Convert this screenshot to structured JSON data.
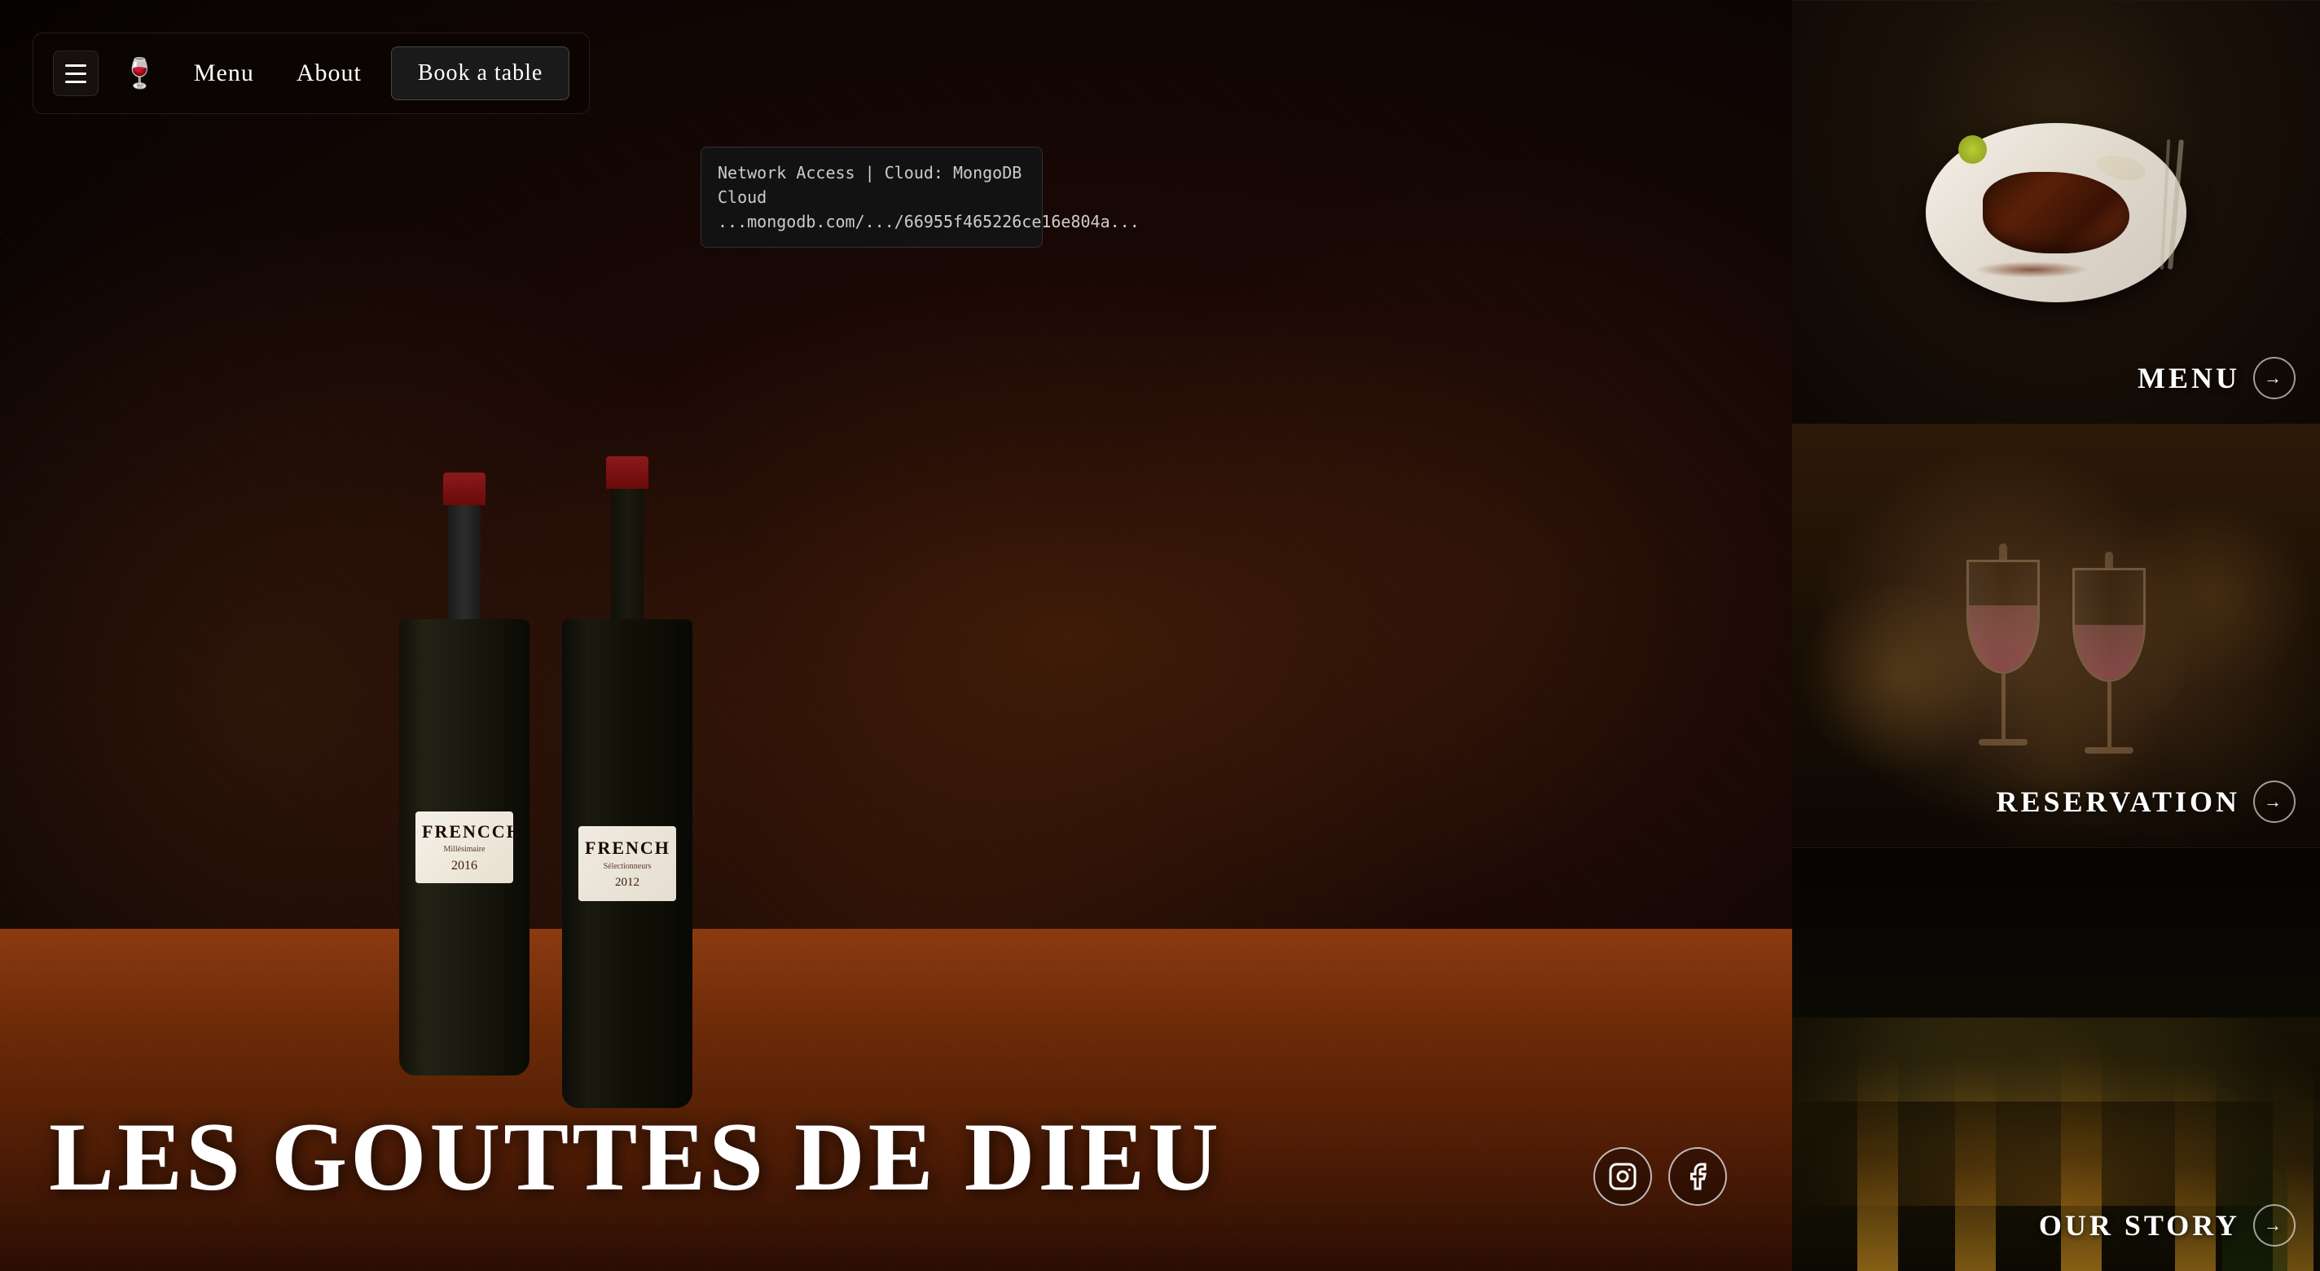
{
  "navbar": {
    "menu_label": "Menu",
    "about_label": "About",
    "book_label": "Book a table"
  },
  "hero": {
    "title": "LES GOUTTES DE DIEU",
    "bottle_left": {
      "brand": "FRENCCH",
      "sub": "Millésimaire",
      "year": "2016"
    },
    "bottle_right": {
      "brand": "FRENCH",
      "sub": "Sélectionneurs",
      "year": "2012"
    }
  },
  "tooltip": {
    "line1": "Network Access | Cloud: MongoDB Cloud",
    "line2": "...mongodb.com/.../66955f465226ce16e804a..."
  },
  "social": {
    "instagram_label": "instagram-icon",
    "facebook_label": "facebook-icon"
  },
  "right_panel": {
    "menu_card": {
      "label": "MENU",
      "arrow": "→"
    },
    "reservation_card": {
      "label": "RESERVATION",
      "arrow": "→"
    },
    "story_card": {
      "label": "OUR STORY",
      "arrow": "→"
    }
  }
}
